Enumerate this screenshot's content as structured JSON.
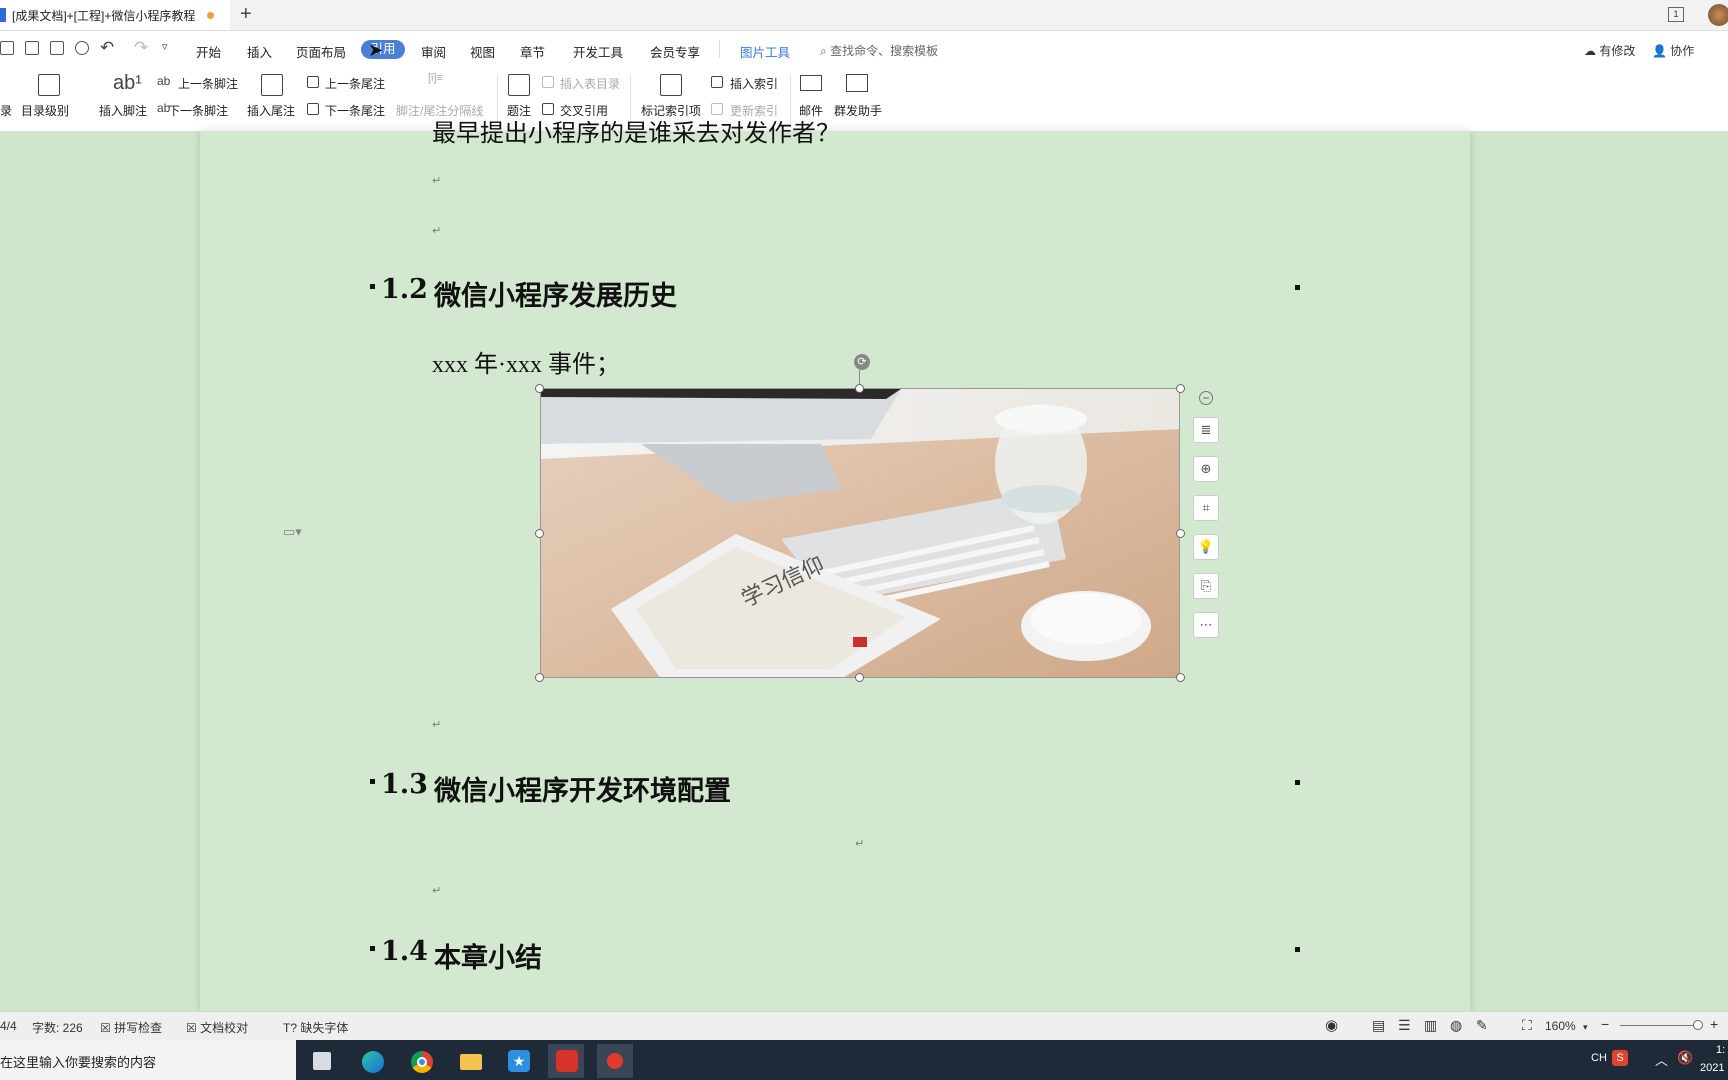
{
  "window": {
    "tab_title": "[成果文档]+[工程]+微信小程序教程",
    "page_indicator": "1"
  },
  "menu": {
    "items": [
      "开始",
      "插入",
      "页面布局",
      "引用",
      "审阅",
      "视图",
      "章节",
      "开发工具",
      "会员专享",
      "图片工具"
    ],
    "active": "引用",
    "search_placeholder": "查找命令、搜索模板",
    "has_edits": "有修改",
    "collab": "协作"
  },
  "ribbon": {
    "toc_label": "录",
    "toc_level": "目录级别",
    "insert_footnote": "插入脚注",
    "prev_footnote": "上一条脚注",
    "next_footnote": "下一条脚注",
    "insert_endnote": "插入尾注",
    "prev_endnote": "上一条尾注",
    "next_endnote": "下一条尾注",
    "separator_line": "脚注/尾注分隔线",
    "caption": "题注",
    "insert_table_of_figures": "插入表目录",
    "cross_ref": "交叉引用",
    "mark_index": "标记索引项",
    "insert_index": "插入索引",
    "update_index": "更新索引",
    "mail": "邮件",
    "mass_send": "群发助手"
  },
  "document": {
    "top_partial_line": "最早提出小程序的是谁采去对发作者？",
    "h12_num": "1.2",
    "h12_text": "微信小程序发展历史",
    "para1": "xxx 年·xxx 事件；",
    "h13_num": "1.3",
    "h13_text": "微信小程序开发环境配置",
    "h14_num": "1.4",
    "h14_text": "本章小结",
    "para_mark": "↵"
  },
  "image_tools": [
    "layout-options-icon",
    "zoom-icon",
    "crop-icon",
    "idea-icon",
    "convert-icon",
    "more-icon"
  ],
  "statusbar": {
    "page": "4/4",
    "word_count": "字数: 226",
    "spell_check": "拼写检查",
    "proofread": "文档校对",
    "missing_font": "缺失字体",
    "zoom": "160%"
  },
  "taskbar": {
    "search_placeholder": "在这里输入你要搜索的内容",
    "ime": "CH",
    "time_partial": "1:",
    "date_partial": "2021"
  }
}
